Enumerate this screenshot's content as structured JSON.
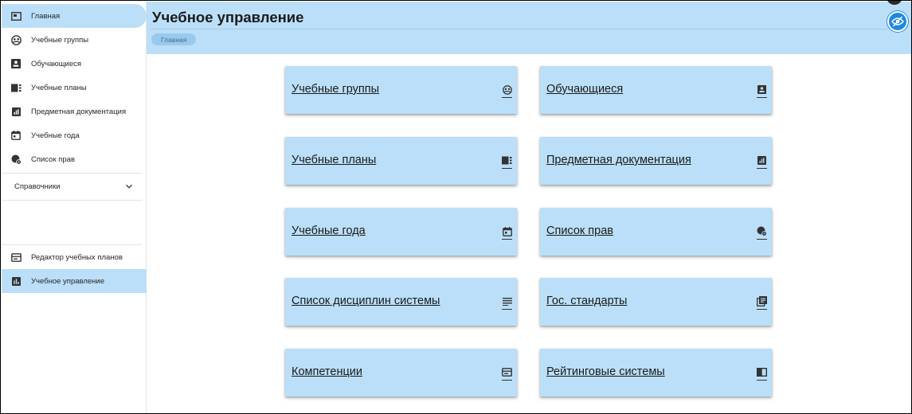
{
  "sidebar": {
    "items": [
      {
        "label": "Главная",
        "icon": "home-panel-icon"
      },
      {
        "label": "Учебные группы",
        "icon": "groups-icon"
      },
      {
        "label": "Обучающиеся",
        "icon": "student-badge-icon"
      },
      {
        "label": "Учебные планы",
        "icon": "plans-icon"
      },
      {
        "label": "Предметная документация",
        "icon": "documentation-icon"
      },
      {
        "label": "Учебные года",
        "icon": "calendar-icon"
      },
      {
        "label": "Список прав",
        "icon": "permissions-icon"
      }
    ],
    "section": {
      "label": "Справочники",
      "icon": "chevron-down-icon"
    },
    "bottom_items": [
      {
        "label": "Редактор учебных планов",
        "icon": "editor-icon"
      },
      {
        "label": "Учебное управление",
        "icon": "bar-chart-icon"
      }
    ]
  },
  "header": {
    "title": "Учебное управление",
    "breadcrumb": "Главная"
  },
  "cards": [
    {
      "label": "Учебные группы",
      "icon": "groups-icon"
    },
    {
      "label": "Обучающиеся",
      "icon": "student-badge-icon"
    },
    {
      "label": "Учебные планы",
      "icon": "plans-icon"
    },
    {
      "label": "Предметная документация",
      "icon": "documentation-icon"
    },
    {
      "label": "Учебные года",
      "icon": "calendar-icon"
    },
    {
      "label": "Список прав",
      "icon": "permissions-icon"
    },
    {
      "label": "Список дисциплин системы",
      "icon": "list-lines-icon"
    },
    {
      "label": "Гос. стандарты",
      "icon": "library-books-icon"
    },
    {
      "label": "Компетенции",
      "icon": "web-window-icon"
    },
    {
      "label": "Рейтинговые системы",
      "icon": "book-icon"
    }
  ],
  "colors": {
    "accent_light": "#bbdff8",
    "accent": "#1e88e5",
    "breadcrumb_bg": "#99caee"
  }
}
